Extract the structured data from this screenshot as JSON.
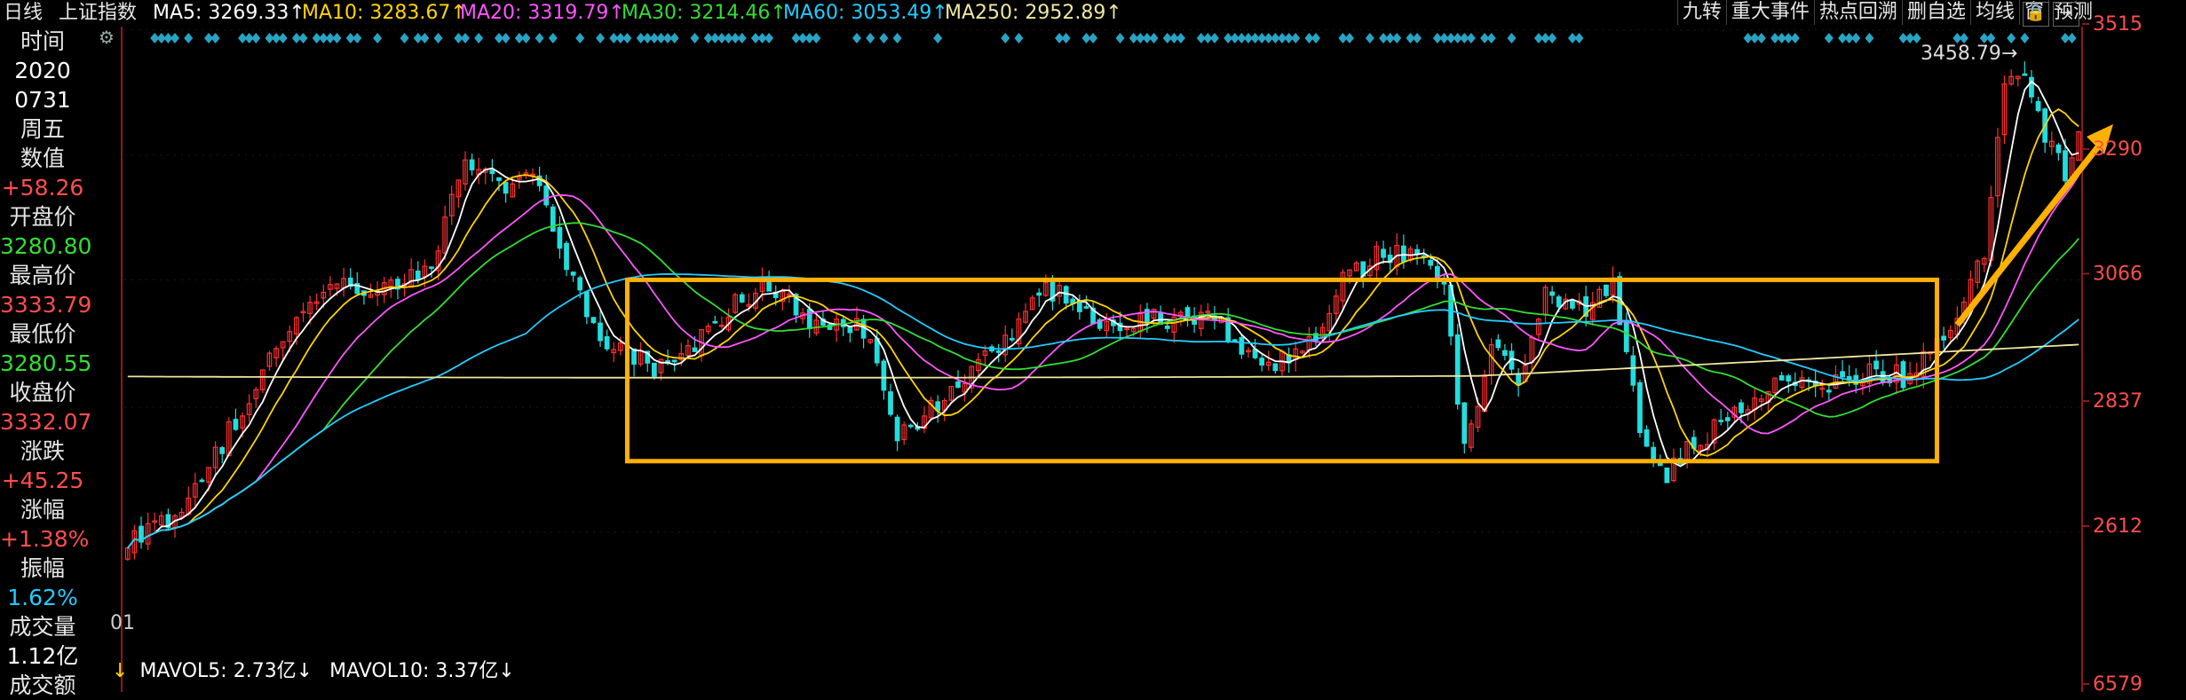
{
  "header": {
    "period": "日线",
    "index_name": "上证指数",
    "ma_items": [
      {
        "label": "MA5: 3269.33↑",
        "color": "#ffffff"
      },
      {
        "label": "MA10: 3283.67↑",
        "color": "#ffd400"
      },
      {
        "label": "MA20: 3319.79↑",
        "color": "#ff55ff"
      },
      {
        "label": "MA30: 3214.46↑",
        "color": "#33dd33"
      },
      {
        "label": "MA60: 3053.49↑",
        "color": "#22ccff"
      },
      {
        "label": "MA250: 2952.89↑",
        "color": "#f0e6a0"
      }
    ],
    "buttons": [
      "九转",
      "重大事件",
      "热点回溯",
      "删自选",
      "均线",
      "窗",
      "预测"
    ],
    "icon_lock": "🔒",
    "icon_exit": "⇥"
  },
  "info_panel": [
    {
      "label": "时间",
      "value": ""
    },
    {
      "label": "2020",
      "value": "0731"
    },
    {
      "label": "周五",
      "value": ""
    },
    {
      "label": "数值",
      "value": "+58.26"
    },
    {
      "label": "开盘价",
      "value": "3280.80"
    },
    {
      "label": "最高价",
      "value": "3333.79"
    },
    {
      "label": "最低价",
      "value": "3280.55"
    },
    {
      "label": "收盘价",
      "value": "3332.07"
    },
    {
      "label": "涨跌",
      "value": "+45.25"
    },
    {
      "label": "涨幅",
      "value": "+1.38%"
    },
    {
      "label": "振幅",
      "value": "1.62%"
    },
    {
      "label": "成交量",
      "value": "1.12亿"
    },
    {
      "label": "成交额",
      "value": ""
    }
  ],
  "info_colors": {
    "2020": "#ffffff",
    "数值": "#ff4d4d",
    "开盘价": "#33dd33",
    "最高价": "#ff4d4d",
    "最低价": "#33dd33",
    "收盘价": "#ff4d4d",
    "涨跌": "#ff4d4d",
    "涨幅": "#ff4d4d",
    "振幅": "#22ccff",
    "成交量": "#ffffff"
  },
  "left_axis_stub": "01",
  "volume_bar": {
    "prefix": "↓",
    "mavol5": "MAVOL5: 2.73亿↓",
    "mavol10": "MAVOL10: 3.37亿↓"
  },
  "right_axis": {
    "labels": [
      "3515",
      "3290",
      "3066",
      "2837",
      "2612",
      "6579"
    ]
  },
  "annotations": {
    "peak_label": "3458.79→"
  },
  "chart_data": {
    "type": "line",
    "title": "",
    "xlabel": "",
    "ylabel": "",
    "ylim": [
      2400,
      3515
    ],
    "yticks": [
      2612,
      2837,
      3066,
      3290,
      3515
    ],
    "n_days": 290,
    "series": [
      {
        "name": "MA5",
        "color": "#ffffff"
      },
      {
        "name": "MA10",
        "color": "#ffd400"
      },
      {
        "name": "MA20",
        "color": "#ff55ff"
      },
      {
        "name": "MA30",
        "color": "#33dd33"
      },
      {
        "name": "MA60",
        "color": "#22ccff"
      },
      {
        "name": "MA250",
        "color": "#f0e6a0"
      }
    ],
    "close_keyframes": [
      [
        0,
        2600
      ],
      [
        8,
        2640
      ],
      [
        20,
        2900
      ],
      [
        30,
        3060
      ],
      [
        38,
        3050
      ],
      [
        45,
        3080
      ],
      [
        50,
        3280
      ],
      [
        55,
        3230
      ],
      [
        60,
        3250
      ],
      [
        65,
        3100
      ],
      [
        70,
        2950
      ],
      [
        75,
        2930
      ],
      [
        80,
        2900
      ],
      [
        85,
        2970
      ],
      [
        90,
        3020
      ],
      [
        95,
        3060
      ],
      [
        100,
        3000
      ],
      [
        105,
        2990
      ],
      [
        110,
        2970
      ],
      [
        114,
        2780
      ],
      [
        118,
        2820
      ],
      [
        125,
        2910
      ],
      [
        130,
        2960
      ],
      [
        135,
        3050
      ],
      [
        140,
        3030
      ],
      [
        145,
        2990
      ],
      [
        150,
        3000
      ],
      [
        155,
        2990
      ],
      [
        160,
        3010
      ],
      [
        165,
        2950
      ],
      [
        170,
        2920
      ],
      [
        175,
        2950
      ],
      [
        180,
        3060
      ],
      [
        185,
        3110
      ],
      [
        190,
        3120
      ],
      [
        195,
        3060
      ],
      [
        198,
        2760
      ],
      [
        202,
        2950
      ],
      [
        206,
        2880
      ],
      [
        210,
        3050
      ],
      [
        216,
        3000
      ],
      [
        220,
        3070
      ],
      [
        224,
        2800
      ],
      [
        228,
        2720
      ],
      [
        232,
        2770
      ],
      [
        238,
        2820
      ],
      [
        245,
        2880
      ],
      [
        252,
        2880
      ],
      [
        258,
        2900
      ],
      [
        264,
        2890
      ],
      [
        270,
        2990
      ],
      [
        275,
        3110
      ],
      [
        278,
        3420
      ],
      [
        281,
        3450
      ],
      [
        284,
        3330
      ],
      [
        287,
        3260
      ],
      [
        289,
        3310
      ]
    ],
    "peak": 3458.79,
    "consolidation_box": {
      "day_start": 74,
      "day_end": 268,
      "top": 3066,
      "bottom": 2740
    }
  }
}
